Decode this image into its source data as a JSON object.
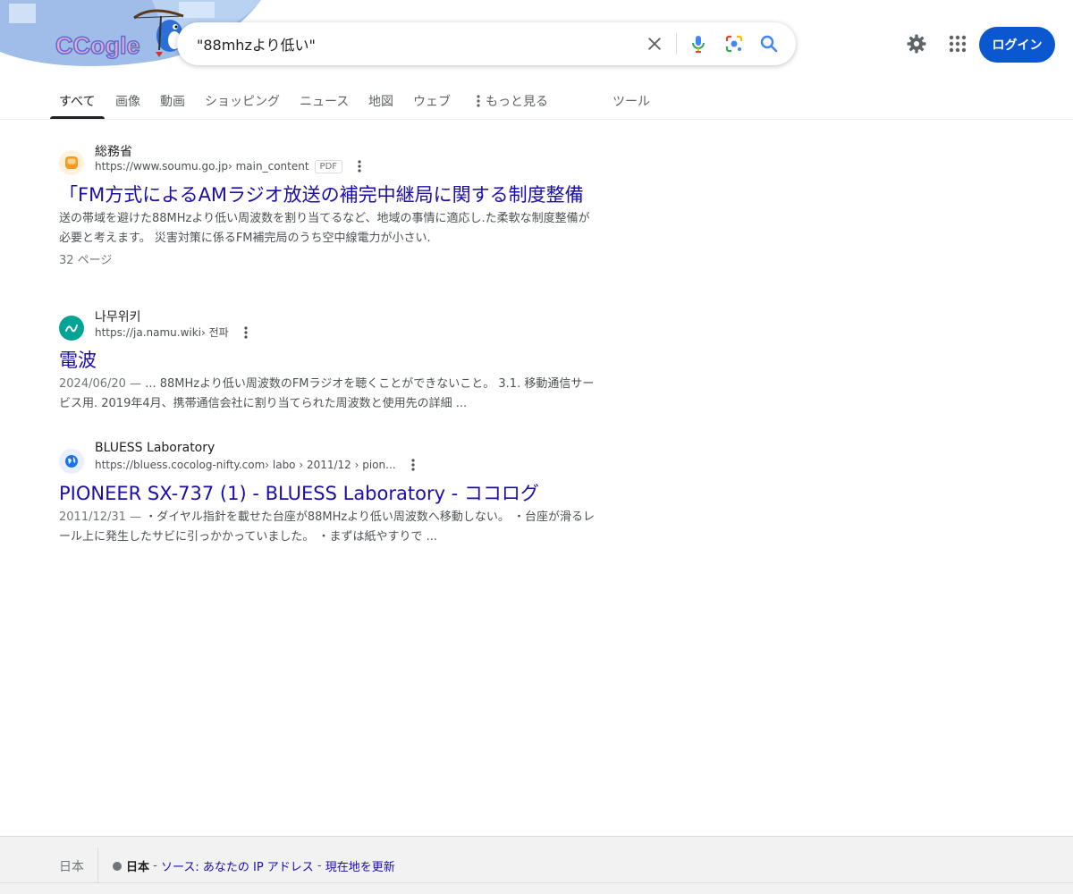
{
  "search": {
    "query": "\"88mhzより低い\""
  },
  "header": {
    "login_label": "ログイン",
    "doodle_text": "CCogle"
  },
  "tabs": [
    {
      "label": "すべて",
      "active": true
    },
    {
      "label": "画像"
    },
    {
      "label": "動画"
    },
    {
      "label": "ショッピング"
    },
    {
      "label": "ニュース"
    },
    {
      "label": "地図"
    },
    {
      "label": "ウェブ"
    },
    {
      "label": "もっと見る"
    },
    {
      "label": "ツール"
    }
  ],
  "results": [
    {
      "site_name": "総務省",
      "url": "https://www.soumu.go.jp",
      "path": " › main_content",
      "badge": "PDF",
      "title": "「FM方式によるAMラジオ放送の補完中継局に関する制度整備",
      "snippet_date": "",
      "snippet": "送の帯域を避けた88MHzより低い周波数を割り当てるなど、地域の事情に適応し.た柔軟な制度整備が必要と考えます。 災害対策に係るFM補完局のうち空中線電力が小さい.",
      "pages": "32 ページ"
    },
    {
      "site_name": "나무위키",
      "url": "https://ja.namu.wiki",
      "path": " › 전파",
      "title": "電波",
      "snippet_date": "2024/06/20 — ",
      "snippet": "... 88MHzより低い周波数のFMラジオを聴くことができないこと。 3.1. 移動通信サービス用. 2019年4月、携帯通信会社に割り当てられた周波数と使用先の詳細 ..."
    },
    {
      "site_name": "BLUESS Laboratory",
      "url": "https://bluess.cocolog-nifty.com",
      "path": " › labo › 2011/12 › pion...",
      "title": "PIONEER SX-737 (1) - BLUESS Laboratory - ココログ",
      "snippet_date": "2011/12/31 — ",
      "snippet": "・ダイヤル指針を載せた台座が88MHzより低い周波数へ移動しない。 ・台座が滑るレール上に発生したサビに引っかかっていました。 ・まずは紙やすりで ..."
    }
  ],
  "footer": {
    "country": "日本",
    "location_bold": "日本",
    "sep1": " - ",
    "source_link": "ソース: あなたの IP アドレス",
    "sep2": " - ",
    "update_link": "現在地を更新"
  },
  "colors": {
    "link": "#1a0dab",
    "accent": "#0b57d0"
  }
}
